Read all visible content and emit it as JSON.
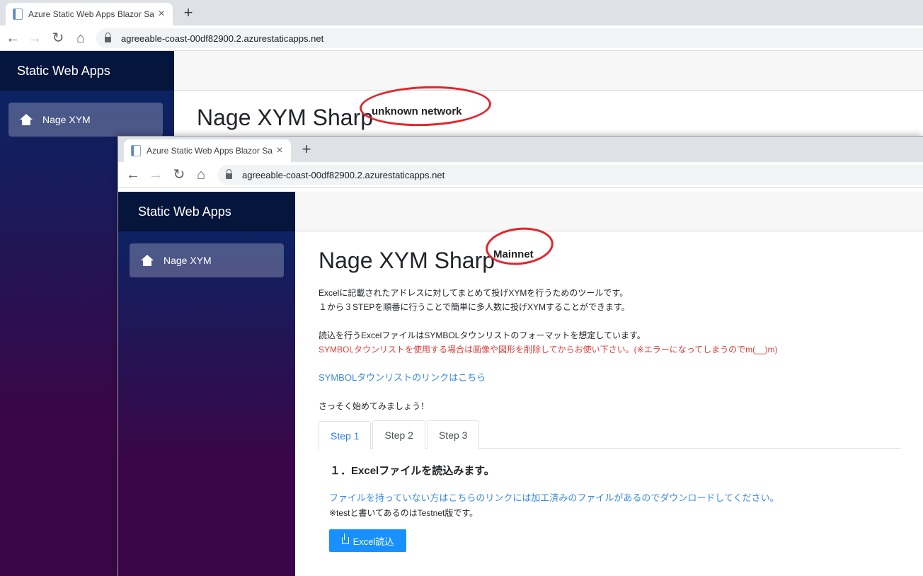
{
  "windows": [
    {
      "tab": {
        "title": "Azure Static Web Apps Blazor Sa",
        "close": "×"
      },
      "new_tab": "+",
      "url": "agreeable-coast-00df82900.2.azurestaticapps.net",
      "brand": "Static Web Apps",
      "nav_item": "Nage XYM",
      "page_title": "Nage XYM Sharp",
      "network_annotation": "unknown network"
    },
    {
      "tab": {
        "title": "Azure Static Web Apps Blazor Sa",
        "close": "×"
      },
      "new_tab": "+",
      "url": "agreeable-coast-00df82900.2.azurestaticapps.net",
      "brand": "Static Web Apps",
      "nav_item": "Nage XYM",
      "page_title": "Nage XYM Sharp",
      "network_annotation": "Mainnet",
      "intro_1": "Excelに記載されたアドレスに対してまとめて投げXYMを行うためのツールです。",
      "intro_2": "１から３STEPを順番に行うことで簡単に多人数に投げXYMすることができます。",
      "format_note": "読込を行うExcelファイルはSYMBOLタウンリストのフォーマットを想定しています。",
      "warning": "SYMBOLタウンリストを使用する場合は画像や図形を削除してからお使い下さい。(※エラーになってしまうのでm(__)m)",
      "town_link": "SYMBOLタウンリストのリンクはこちら",
      "start": "さっそく始めてみましょう！",
      "tabs": [
        {
          "label": "Step 1",
          "active": true
        },
        {
          "label": "Step 2",
          "active": false
        },
        {
          "label": "Step 3",
          "active": false
        }
      ],
      "step_title": "１．Excelファイルを読込みます。",
      "download_link": "ファイルを持っていない方はこちらのリンクには加工済みのファイルがあるのでダウンロードしてください。",
      "test_note": "※testと書いてあるのはTestnet版です。",
      "excel_button": "Excel読込"
    }
  ],
  "colors": {
    "annotation": "#e3242b",
    "accent": "#1890ff",
    "warning": "#e0403c",
    "link": "#3b8be0"
  }
}
